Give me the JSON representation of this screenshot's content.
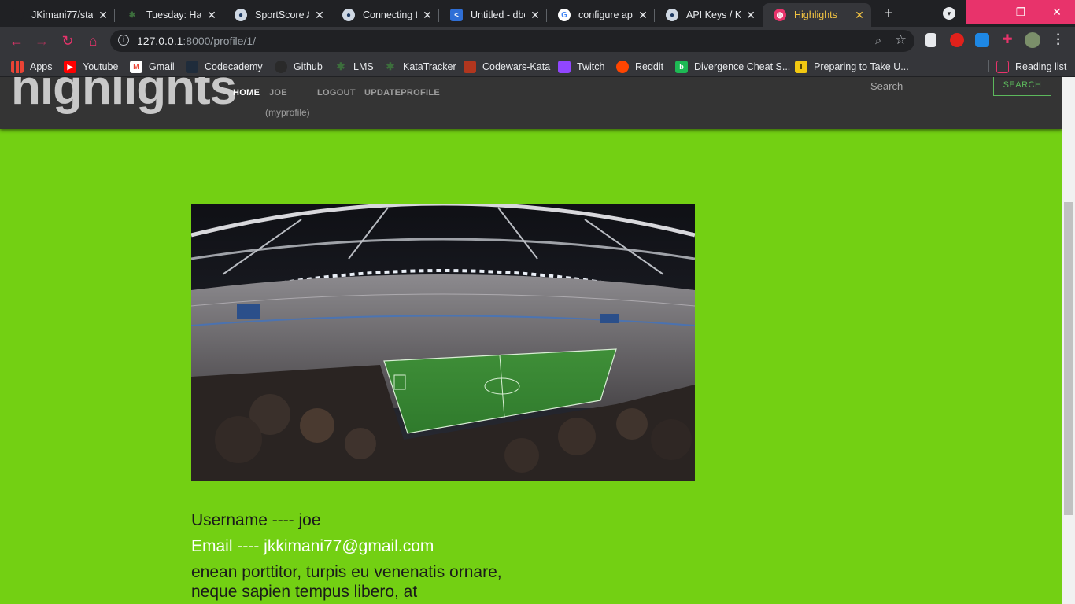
{
  "browser": {
    "tabs": [
      {
        "title": "JKimani77/sta",
        "favicon": "github"
      },
      {
        "title": "Tuesday: Hand",
        "favicon": "palm"
      },
      {
        "title": "SportScore AI",
        "favicon": "octopus"
      },
      {
        "title": "Connecting to",
        "favicon": "octopus"
      },
      {
        "title": "Untitled - dbc",
        "favicon": "share"
      },
      {
        "title": "configure api",
        "favicon": "google"
      },
      {
        "title": "API Keys / Key",
        "favicon": "octopus"
      },
      {
        "title": "Highlights",
        "favicon": "globe",
        "active": true
      }
    ],
    "new_tab_label": "+",
    "window_controls": {
      "minimize": "—",
      "maximize": "❐",
      "close": "✕"
    },
    "url_host": "127.0.0.1",
    "url_rest": ":8000/profile/1/",
    "bookmarks": [
      {
        "label": "Apps",
        "icon": "apps-grid"
      },
      {
        "label": "Youtube",
        "icon": "youtube",
        "color": "#ff0000"
      },
      {
        "label": "Gmail",
        "icon": "gmail"
      },
      {
        "label": "Codecademy",
        "icon": "codecademy"
      },
      {
        "label": "Github",
        "icon": "github"
      },
      {
        "label": "LMS",
        "icon": "palm"
      },
      {
        "label": "KataTracker",
        "icon": "palm"
      },
      {
        "label": "Codewars-Kata",
        "icon": "codewars",
        "color": "#b1361e"
      },
      {
        "label": "Twitch",
        "icon": "twitch",
        "color": "#9146ff"
      },
      {
        "label": "Reddit",
        "icon": "reddit",
        "color": "#ff4500"
      },
      {
        "label": "Divergence Cheat S...",
        "icon": "b-badge",
        "color": "#1db954"
      },
      {
        "label": "Preparing to Take U...",
        "icon": "i-badge",
        "color": "#f2c811"
      }
    ],
    "reading_list": "Reading list"
  },
  "site": {
    "brand": "highlights",
    "nav": {
      "home": "HOME",
      "user": "JOE",
      "myprofile": "(myprofile)",
      "logout": "LOGOUT",
      "update": "UPDATEPROFILE"
    },
    "search_placeholder": "Search",
    "search_button": "SEARCH"
  },
  "profile": {
    "username_line": "Username ---- joe",
    "email_line": "Email ---- jkkimani77@gmail.com",
    "bio": "enean porttitor, turpis eu venenatis ornare, neque sapien tempus libero, at"
  },
  "colors": {
    "page_bg": "#73d013",
    "navbar_bg": "#343434",
    "accent_pink": "#e8336b",
    "active_tab_text": "#f4c542"
  }
}
